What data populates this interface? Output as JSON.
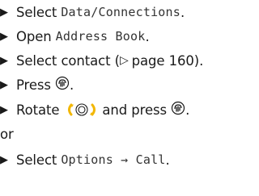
{
  "steps": [
    {
      "text": "Select",
      "code": "Data/Connections",
      "end": "."
    },
    {
      "text": "Open",
      "code": "Address Book",
      "end": "."
    },
    {
      "text": "Select contact (",
      "ref_symbol": "▷",
      "ref_text": "page 160)."
    },
    {
      "text": "Press",
      "icon": "press-knob-icon",
      "end": "."
    },
    {
      "text": "Rotate",
      "icon": "rotate-knob-icon",
      "middle": "and press",
      "icon2": "press-knob-icon",
      "end": "."
    },
    {
      "text": "Select",
      "code": "Options → Call",
      "end": "."
    }
  ],
  "connector": "or"
}
